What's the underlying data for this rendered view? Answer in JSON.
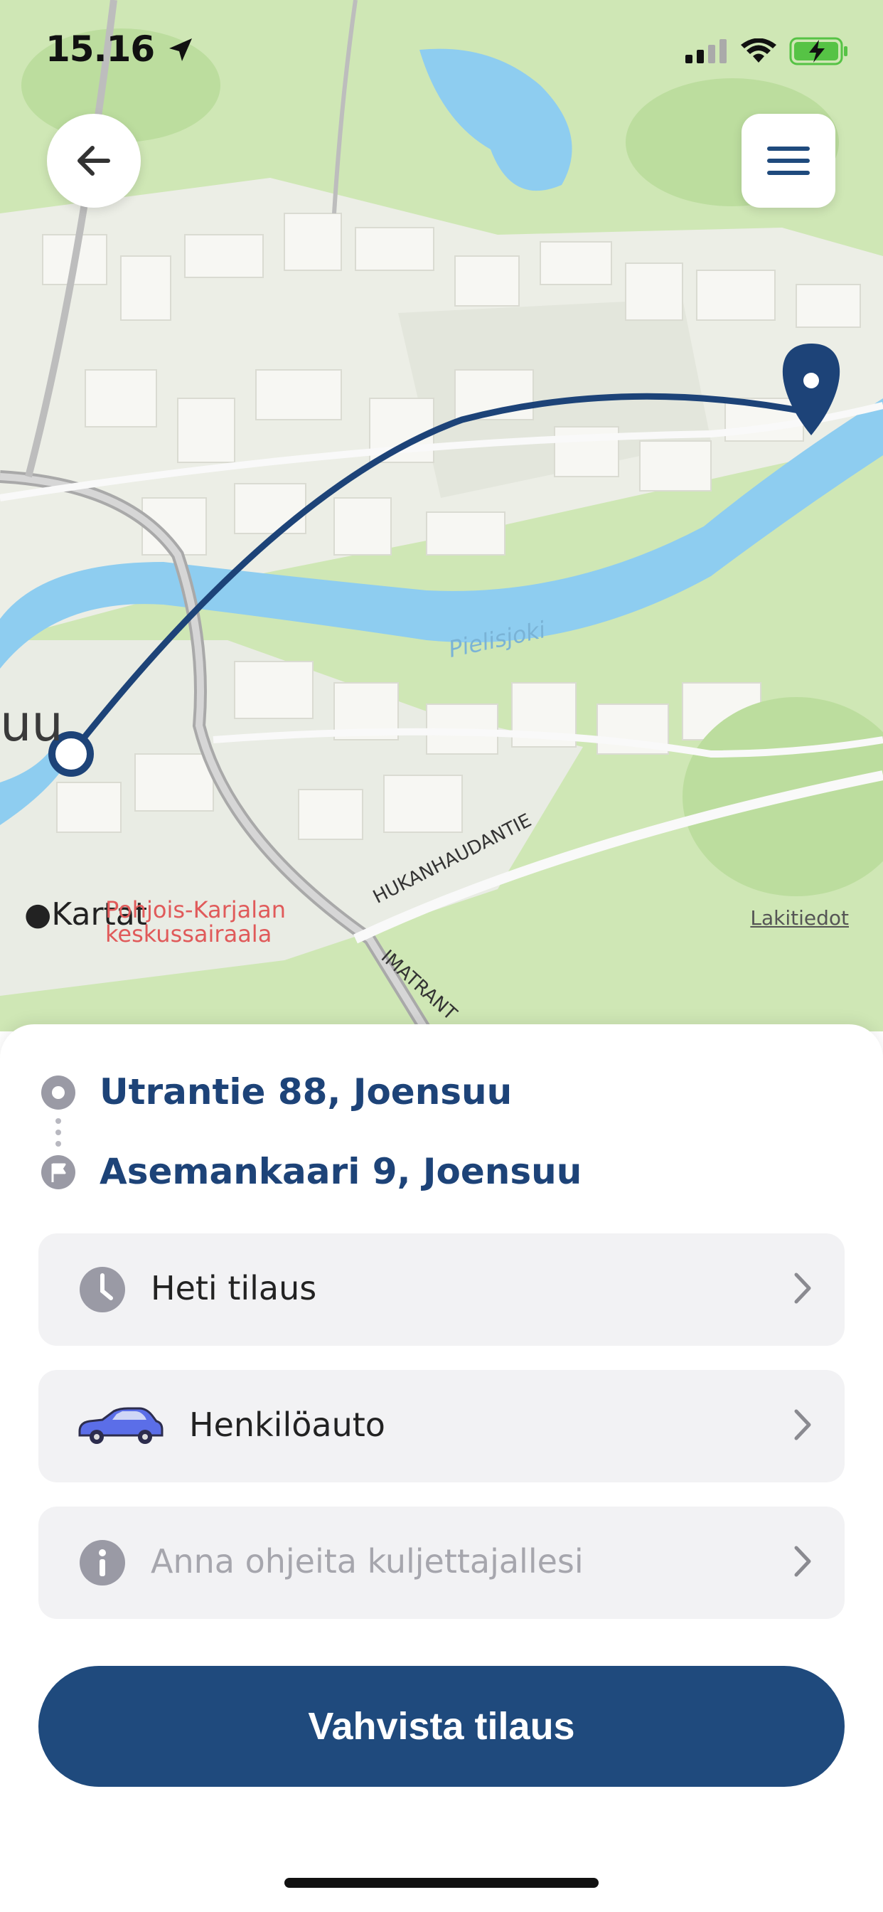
{
  "status_bar": {
    "time": "15.16"
  },
  "map": {
    "labels": {
      "river": "Pielisjoki",
      "road1": "HUKANHAUDANTIE",
      "road2": "IMATRANT",
      "city_fragment": "uu",
      "hospital": "Pohjois-Karjalan keskussairaala",
      "apple_maps": "Kartat",
      "legal": "Lakitiedot"
    }
  },
  "route": {
    "origin": "Utrantie 88, Joensuu",
    "destination": "Asemankaari 9, Joensuu"
  },
  "options": [
    {
      "label": "Heti tilaus",
      "icon": "clock-icon"
    },
    {
      "label": "Henkilöauto",
      "icon": "car-icon"
    },
    {
      "label": "Anna ohjeita kuljettajallesi",
      "icon": "info-icon"
    }
  ],
  "confirm_label": "Vahvista tilaus",
  "colors": {
    "accent": "#1f4a7d",
    "route": "#1d4378",
    "water": "#8ecdf0",
    "park": "#cfe7b5"
  }
}
